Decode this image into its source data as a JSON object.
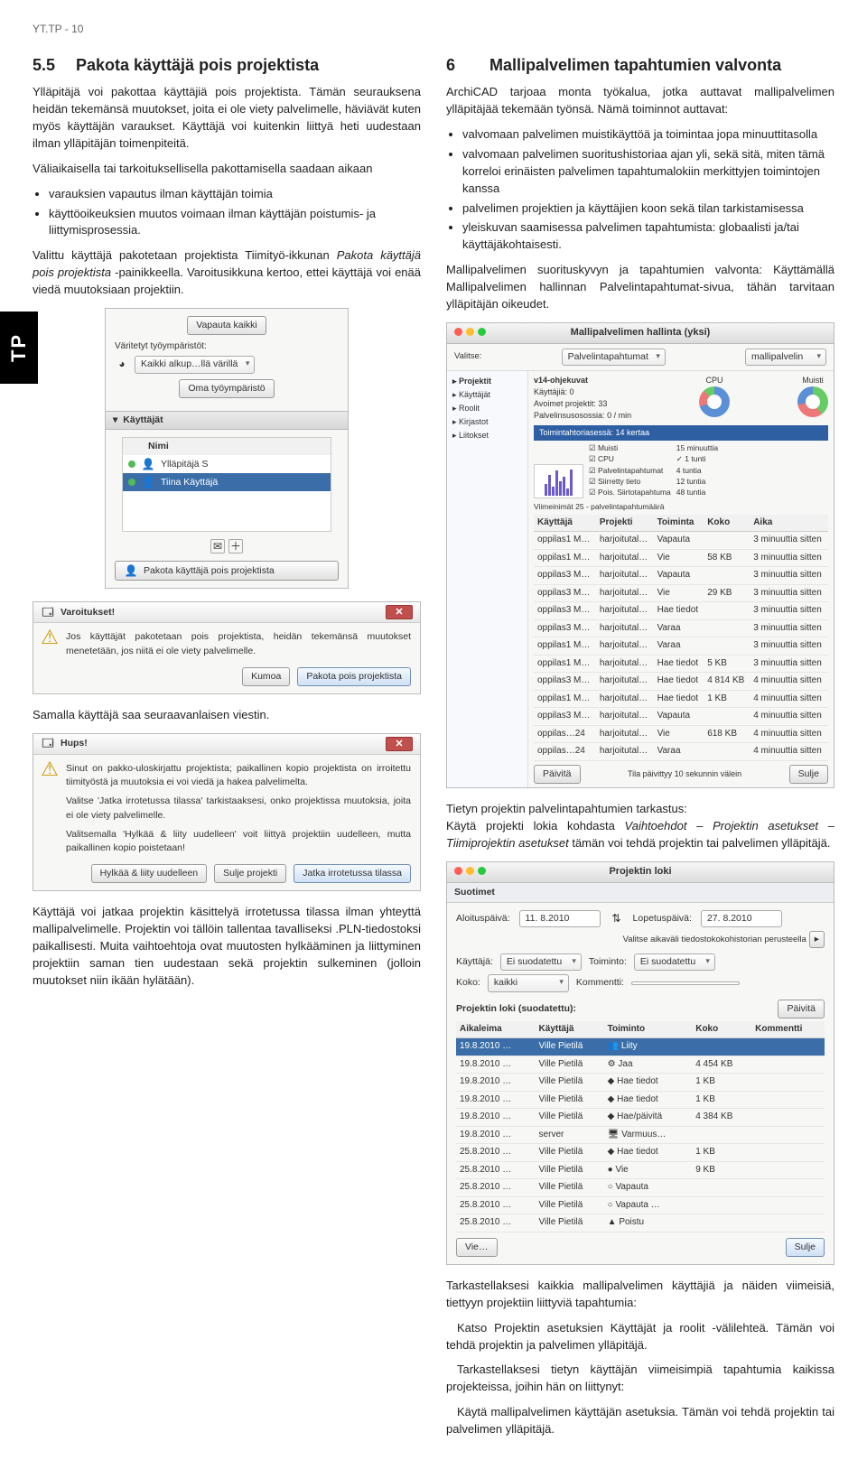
{
  "header": "YT.TP - 10",
  "side_tab": "TP",
  "left": {
    "sec_num": "5.5",
    "sec_title": "Pakota käyttäjä pois projektista",
    "p1": "Ylläpitäjä voi pakottaa käyttäjiä pois projektista. Tämän seurauksena heidän tekemänsä muutokset, joita ei ole viety palvelimelle, häviävät kuten myös käyttäjän varaukset. Käyttäjä voi kuitenkin liittyä heti uudestaan ilman ylläpitäjän toimenpiteitä.",
    "p2": "Väliaikaisella tai tarkoituksellisella pakottamisella saadaan aikaan",
    "b1": "varauksien vapautus ilman käyttäjän toimia",
    "b2": "käyttöoikeuksien muutos voimaan ilman käyttäjän poistumis- ja liittymisprosessia.",
    "p3a": "Valittu käyttäjä pakotetaan projektista Tiimityö-ikkunan ",
    "p3i": "Pakota käyttäjä pois projektista",
    "p3b": " -painikkeella. Varoitusikkuna kertoo, ettei käyttäjä voi enää viedä muutoksiaan projektiin.",
    "tw": {
      "release_all": "Vapauta kaikki",
      "colored_env": "Väritetyt työympäristöt:",
      "combo": "Kaikki alkup…llä värillä",
      "own_env": "Oma työympäristö",
      "users_section": "Käyttäjät",
      "col_name": "Nimi",
      "user1": "Ylläpitäjä S",
      "user2": "Tiina Käyttäjä",
      "force_btn": "Pakota käyttäjä pois projektista"
    },
    "warn": {
      "title": "Varoitukset!",
      "msg": "Jos käyttäjät pakotetaan pois projektista, heidän tekemänsä muutokset menetetään, jos niitä ei ole viety palvelimelle.",
      "cancel": "Kumoa",
      "ok": "Pakota pois projektista"
    },
    "p4": "Samalla käyttäjä saa seuraavanlaisen viestin.",
    "hups": {
      "title": "Hups!",
      "msg1": "Sinut on pakko-uloskirjattu projektista; paikallinen kopio projektista on irroitettu tiimityöstä ja muutoksia ei voi viedä ja hakea palvelimelta.",
      "msg2": "Valitse 'Jatka irrotetussa tilassa' tarkistaaksesi, onko projektissa muutoksia, joita ei ole viety palvelimelle.",
      "msg3": "Valitsemalla 'Hylkää & liity uudelleen' voit liittyä projektiin uudelleen, mutta paikallinen kopio poistetaan!",
      "btn1": "Hylkää & liity uudelleen",
      "btn2": "Sulje projekti",
      "btn3": "Jatka irrotetussa tilassa"
    },
    "p5": "Käyttäjä voi jatkaa projektin käsittelyä irrotetussa tilassa ilman yhteyttä mallipalvelimelle. Projektin voi tällöin tallentaa tavalliseksi .PLN-tiedostoksi paikallisesti. Muita vaihtoehtoja ovat muutosten hylkääminen ja liittyminen projektiin saman tien uudestaan sekä projektin sulkeminen (jolloin muutokset niin ikään hylätään)."
  },
  "right": {
    "sec_num": "6",
    "sec_title": "Mallipalvelimen tapahtumien valvonta",
    "p1": "ArchiCAD tarjoaa monta työkalua, jotka auttavat mallipalvelimen ylläpitäjää tekemään työnsä. Nämä toiminnot auttavat:",
    "b1": "valvomaan palvelimen muistikäyttöä ja toimintaa jopa minuuttitasolla",
    "b2": "valvomaan palvelimen suoritushistoriaa ajan yli, sekä sitä, miten tämä korreloi erinäisten palvelimen tapahtumalokiin merkittyjen toimintojen kanssa",
    "b3": "palvelimen projektien ja käyttäjien koon sekä tilan tarkistamisessa",
    "b4": "yleiskuvan saamisessa palvelimen tapahtumista: globaalisti ja/tai käyttäjäkohtaisesti.",
    "p2": "Mallipalvelimen suorituskyvyn ja tapahtumien valvonta: Käyttämällä Mallipalvelimen hallinnan Palvelintapahtumat-sivua, tähän tarvitaan ylläpitäjän oikeudet.",
    "monitor": {
      "title": "Mallipalvelimen hallinta (yksi)",
      "server_combo": "mallipalvelin",
      "side_items": [
        "Projektit",
        "Käyttäjät",
        "Roolit",
        "Kirjastot",
        "Liitokset"
      ],
      "active_tab": "Palvelintapahtumat",
      "proj_name": "v14-ohjekuvat",
      "users_lbl": "Käyttäjiä:",
      "users_val": "0",
      "open_lbl": "Avoimet projektit:",
      "open_val": "33",
      "rate_lbl": "Palvelinsusosossia:",
      "rate_val": "0 / min",
      "cpu_lbl": "CPU",
      "mem_lbl": "Muisti",
      "filter_bar": "Toimintahtoriasessä: 14 kertaa",
      "legend": [
        "Muisti",
        "CPU",
        "Palvelintapahtumat",
        "Siirretty tieto",
        "Pois. Siirtotapahtuma"
      ],
      "time_opts": [
        "15 minuuttia",
        "1 tunti",
        "4 tuntia",
        "12 tuntia",
        "48 tuntia"
      ],
      "summary": "Viimeinimät 25 - palvelintapahtumäärä",
      "cols": [
        "Käyttäjä",
        "Projekti",
        "Toiminta",
        "Koko",
        "Aika"
      ],
      "rows": [
        {
          "u": "oppilas1 M…",
          "p": "harjoitutal…",
          "a": "Vapauta",
          "k": "",
          "t": "3 minuuttia sitten"
        },
        {
          "u": "oppilas1 M…",
          "p": "harjoitutal…",
          "a": "Vie",
          "k": "58 KB",
          "t": "3 minuuttia sitten"
        },
        {
          "u": "oppilas3 M…",
          "p": "harjoitutal…",
          "a": "Vapauta",
          "k": "",
          "t": "3 minuuttia sitten"
        },
        {
          "u": "oppilas3 M…",
          "p": "harjoitutal…",
          "a": "Vie",
          "k": "29 KB",
          "t": "3 minuuttia sitten"
        },
        {
          "u": "oppilas3 M…",
          "p": "harjoitutal…",
          "a": "Hae tiedot",
          "k": "",
          "t": "3 minuuttia sitten"
        },
        {
          "u": "oppilas3 M…",
          "p": "harjoitutal…",
          "a": "Varaa",
          "k": "",
          "t": "3 minuuttia sitten"
        },
        {
          "u": "oppilas1 M…",
          "p": "harjoitutal…",
          "a": "Varaa",
          "k": "",
          "t": "3 minuuttia sitten"
        },
        {
          "u": "oppilas1 M…",
          "p": "harjoitutal…",
          "a": "Hae tiedot",
          "k": "5 KB",
          "t": "3 minuuttia sitten"
        },
        {
          "u": "oppilas3 M…",
          "p": "harjoitutal…",
          "a": "Hae tiedot",
          "k": "4 814 KB",
          "t": "4 minuuttia sitten"
        },
        {
          "u": "oppilas1 M…",
          "p": "harjoitutal…",
          "a": "Hae tiedot",
          "k": "1 KB",
          "t": "4 minuuttia sitten"
        },
        {
          "u": "oppilas3 M…",
          "p": "harjoitutal…",
          "a": "Vapauta",
          "k": "",
          "t": "4 minuuttia sitten"
        },
        {
          "u": "oppilas…24",
          "p": "harjoitutal…",
          "a": "Vie",
          "k": "618 KB",
          "t": "4 minuuttia sitten"
        },
        {
          "u": "oppilas…24",
          "p": "harjoitutal…",
          "a": "Varaa",
          "k": "",
          "t": "4 minuuttia sitten"
        }
      ],
      "footer_left": "Päivitä",
      "footer_note": "Tila päivittyy 10 sekunnin välein",
      "close": "Sulje"
    },
    "p3a": "Tietyn projektin palvelintapahtumien tarkastus:",
    "p3b": "Käytä projekti lokia kohdasta ",
    "p3i": "Vaihtoehdot – Projektin asetukset – Tiimiprojektin asetukset",
    "p3c": " tämän voi tehdä projektin tai palvelimen ylläpitäjä.",
    "log": {
      "title": "Projektin loki",
      "filters": "Suotimet",
      "start_lbl": "Aloituspäivä:",
      "start_val": "11.  8.2010",
      "end_lbl": "Lopetuspäivä:",
      "end_val": "27.  8.2010",
      "range_note": "Valitse aikaväli tiedostokokohistorian perusteella",
      "user_lbl": "Käyttäjä:",
      "user_val": "Ei suodatettu",
      "action_lbl": "Toiminto:",
      "action_val": "Ei suodatettu",
      "size_lbl": "Koko:",
      "size_val": "kaikki",
      "comment_lbl": "Kommentti:",
      "list_lbl": "Projektin loki (suodatettu):",
      "refresh": "Päivitä",
      "cols": [
        "Aikaleima",
        "Käyttäjä",
        "Toiminto",
        "Koko",
        "Kommentti"
      ],
      "rows": [
        {
          "d": "19.8.2010 …",
          "u": "Ville Pietilä",
          "a": "Liity",
          "k": ""
        },
        {
          "d": "19.8.2010 …",
          "u": "Ville Pietilä",
          "a": "Jaa",
          "k": "4 454 KB"
        },
        {
          "d": "19.8.2010 …",
          "u": "Ville Pietilä",
          "a": "Hae tiedot",
          "k": "1 KB"
        },
        {
          "d": "19.8.2010 …",
          "u": "Ville Pietilä",
          "a": "Hae tiedot",
          "k": "1 KB"
        },
        {
          "d": "19.8.2010 …",
          "u": "Ville Pietilä",
          "a": "Hae/päivitä",
          "k": "4 384 KB"
        },
        {
          "d": "19.8.2010 …",
          "u": "server",
          "a": "Varmuus…",
          "k": ""
        },
        {
          "d": "25.8.2010 …",
          "u": "Ville Pietilä",
          "a": "Hae tiedot",
          "k": "1 KB"
        },
        {
          "d": "25.8.2010 …",
          "u": "Ville Pietilä",
          "a": "Vie",
          "k": "9 KB"
        },
        {
          "d": "25.8.2010 …",
          "u": "Ville Pietilä",
          "a": "Vapauta",
          "k": ""
        },
        {
          "d": "25.8.2010 …",
          "u": "Ville Pietilä",
          "a": "Vapauta …",
          "k": ""
        },
        {
          "d": "25.8.2010 …",
          "u": "Ville Pietilä",
          "a": "Poistu",
          "k": ""
        }
      ],
      "export": "Vie…",
      "close": "Sulje"
    },
    "p4": "Tarkastellaksesi kaikkia mallipalvelimen käyttäjiä ja näiden viimeisiä, tiettyyn projektiin liittyviä tapahtumia:",
    "p5": "Katso Projektin asetuksien Käyttäjät ja roolit -välilehteä. Tämän voi tehdä projektin ja palvelimen ylläpitäjä.",
    "p6": "Tarkastellaksesi tietyn käyttäjän viimeisimpiä tapahtumia kaikissa projekteissa, joihin hän on liittynyt:",
    "p7": "Käytä mallipalvelimen käyttäjän asetuksia. Tämän voi tehdä projektin tai palvelimen ylläpitäjä."
  }
}
